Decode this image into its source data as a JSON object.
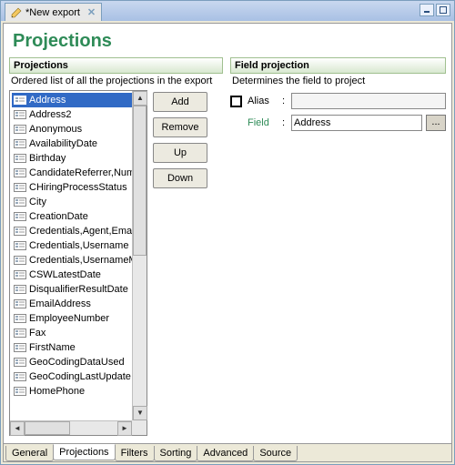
{
  "window": {
    "tab_title": "*New export"
  },
  "page_title": "Projections",
  "left": {
    "header": "Projections",
    "description": "Ordered list of all the projections in the export",
    "items": [
      "Address",
      "Address2",
      "Anonymous",
      "AvailabilityDate",
      "Birthday",
      "CandidateReferrer,Number",
      "CHiringProcessStatus",
      "City",
      "CreationDate",
      "Credentials,Agent,Email",
      "Credentials,Username",
      "Credentials,UsernameM",
      "CSWLatestDate",
      "DisqualifierResultDate",
      "EmailAddress",
      "EmployeeNumber",
      "Fax",
      "FirstName",
      "GeoCodingDataUsed",
      "GeoCodingLastUpdate",
      "HomePhone"
    ],
    "selected_index": 0,
    "buttons": {
      "add": "Add",
      "remove": "Remove",
      "up": "Up",
      "down": "Down"
    }
  },
  "right": {
    "header": "Field projection",
    "description": "Determines the field to project",
    "alias_label": "Alias",
    "alias_value": "",
    "field_label": "Field",
    "field_value": "Address",
    "browse_label": "..."
  },
  "tabs": [
    "General",
    "Projections",
    "Filters",
    "Sorting",
    "Advanced",
    "Source"
  ],
  "active_tab_index": 1
}
